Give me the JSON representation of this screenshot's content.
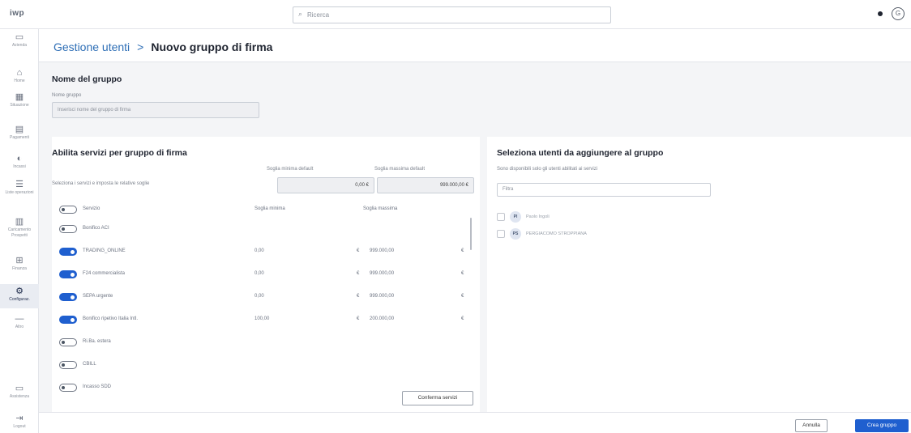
{
  "topbar": {
    "logo": "iwp",
    "search_placeholder": "Ricerca",
    "avatar": "G"
  },
  "sidebar": {
    "items": [
      {
        "label": "Azienda",
        "icon": "building-icon"
      },
      {
        "label": "Home",
        "icon": "home-icon"
      },
      {
        "label": "Situazione",
        "icon": "calculator-icon"
      },
      {
        "label": "Pagamenti",
        "icon": "payments-icon"
      },
      {
        "label": "Incassi",
        "icon": "incassi-icon"
      },
      {
        "label": "Liste operazioni",
        "icon": "list-icon"
      },
      {
        "label": "Caricamento Prospetti",
        "icon": "upload-icon"
      },
      {
        "label": "Finanza",
        "icon": "finance-icon"
      },
      {
        "label": "Configuraz.",
        "icon": "gear-icon",
        "active": true
      },
      {
        "label": "Altro",
        "icon": "more-icon"
      }
    ],
    "bottom_items": [
      {
        "label": "Assistenza",
        "icon": "chat-icon"
      },
      {
        "label": "Logout",
        "icon": "logout-icon"
      }
    ]
  },
  "breadcrumb": {
    "parent": "Gestione utenti",
    "separator": ">",
    "current": "Nuovo gruppo di firma"
  },
  "group_name": {
    "title": "Nome del gruppo",
    "field_label": "Nome gruppo",
    "placeholder": "Inserisci nome del gruppo di firma"
  },
  "services": {
    "title": "Abilita servizi per gruppo di firma",
    "hint": "Seleziona i servizi e imposta le relative soglie",
    "default_min_label": "Soglia minima default",
    "default_min_value": "0,00",
    "default_max_label": "Soglia massima default",
    "default_max_value": "999.000,00",
    "currency": "€",
    "col_service": "Servizio",
    "col_min": "Soglia minima",
    "col_max": "Soglia massima",
    "rows": [
      {
        "name": "Bonifico ACI",
        "enabled": false,
        "min": "",
        "max": ""
      },
      {
        "name": "TRADING_ONLINE",
        "enabled": true,
        "min": "0,00",
        "max": "999.000,00"
      },
      {
        "name": "F24 commercialista",
        "enabled": true,
        "min": "0,00",
        "max": "999.000,00"
      },
      {
        "name": "SEPA urgente",
        "enabled": true,
        "min": "0,00",
        "max": "999.000,00"
      },
      {
        "name": "Bonifico ripetivo Italia Intl.",
        "enabled": true,
        "min": "100,00",
        "max": "200.000,00"
      },
      {
        "name": "Ri.Ba. estera",
        "enabled": false,
        "min": "",
        "max": ""
      },
      {
        "name": "CBILL",
        "enabled": false,
        "min": "",
        "max": ""
      },
      {
        "name": "Incasso SDD",
        "enabled": false,
        "min": "",
        "max": ""
      }
    ],
    "confirm_button": "Conferma servizi"
  },
  "users": {
    "title": "Seleziona utenti da aggiungere al gruppo",
    "hint": "Sono disponibili solo gli utenti abilitati ai servizi",
    "filter_placeholder": "Filtra",
    "list": [
      {
        "initials": "PI",
        "name": "Paolo Ingoli"
      },
      {
        "initials": "PS",
        "name": "PERGIACOMO STROPPIANA"
      }
    ]
  },
  "footer": {
    "cancel_label": "Annulla",
    "create_label": "Crea gruppo"
  },
  "colors": {
    "accent": "#1f5fcf",
    "link": "#2f6fb6"
  }
}
